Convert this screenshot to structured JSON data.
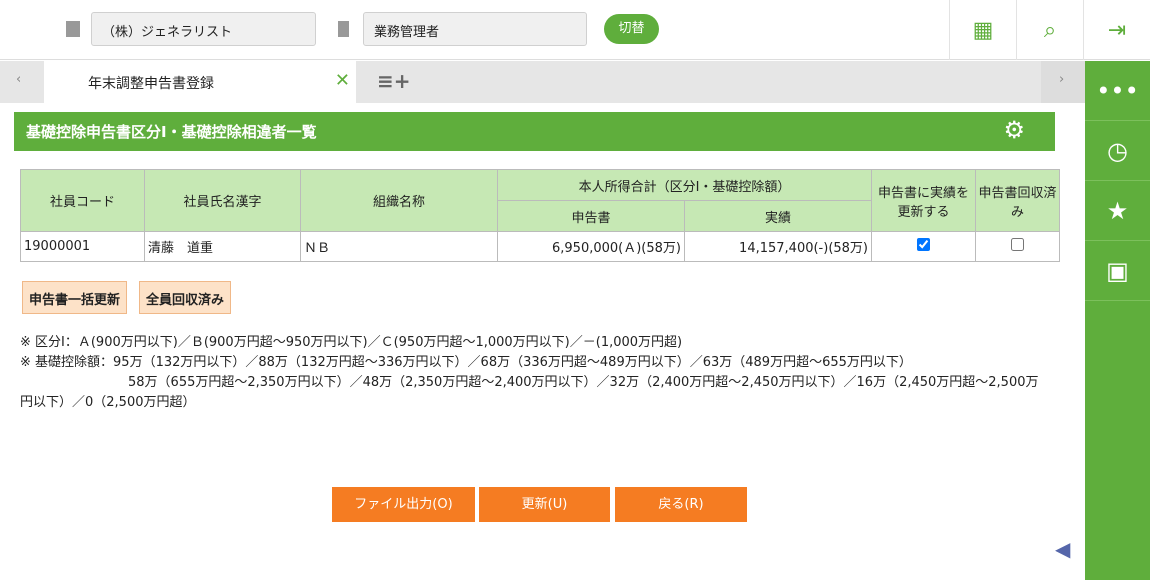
{
  "top": {
    "company": "（株）ジェネラリスト",
    "role": "業務管理者",
    "switch_label": "切替"
  },
  "tabs": {
    "active": "年末調整申告書登録"
  },
  "page": {
    "title": "基礎控除申告書区分Ⅰ・基礎控除相違者一覧"
  },
  "table": {
    "headers": {
      "code": "社員コード",
      "name": "社員氏名漢字",
      "org": "組織名称",
      "income_group": "本人所得合計（区分Ⅰ・基礎控除額）",
      "declared": "申告書",
      "actual": "実績",
      "update": "申告書に実績を更新する",
      "collected": "申告書回収済み"
    },
    "rows": [
      {
        "code": "19000001",
        "name": "清藤　道重",
        "org": "ＮＢ",
        "declared": "6,950,000(Ａ)(58万)",
        "actual": "14,157,400(-)(58万)",
        "update": true,
        "collected": false
      }
    ]
  },
  "buttons": {
    "bulk_update": "申告書一括更新",
    "all_collected": "全員回収済み",
    "file_output": "ファイル出力(O)",
    "update": "更新(U)",
    "back": "戻る(R)"
  },
  "notes": [
    "※ 区分Ⅰ：Ａ(900万円以下)／Ｂ(900万円超～950万円以下)／Ｃ(950万円超～1,000万円以下)／－(1,000万円超)",
    "※ 基礎控除額：95万（132万円以下）／88万（132万円超～336万円以下）／68万（336万円超～489万円以下）／63万（489万円超～655万円以下）",
    "58万（655万円超～2,350万円以下）／48万（2,350万円超～2,400万円以下）／32万（2,400万円超～2,450万円以下）／16万（2,450万円超～2,500万円以下）／0（2,500万円超）"
  ]
}
